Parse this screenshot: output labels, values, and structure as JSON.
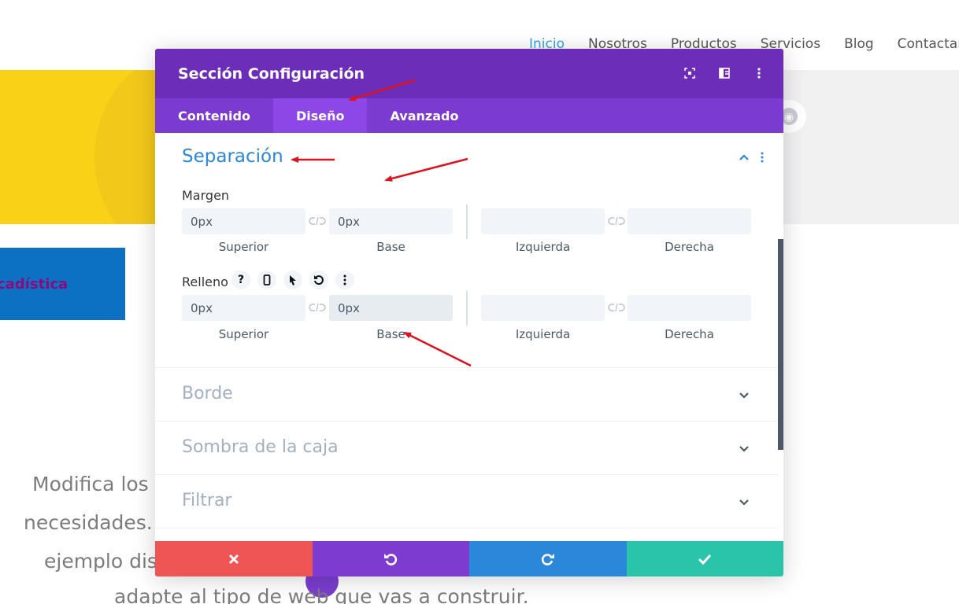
{
  "nav": {
    "items": [
      "Inicio",
      "Nosotros",
      "Productos",
      "Servicios",
      "Blog",
      "Contactar"
    ]
  },
  "background": {
    "blue_button_label": "cadística",
    "text_lines": [
      "Modifica los",
      "necesidades.",
      "ejemplo dis",
      "adapte al tipo de web que vas a construir."
    ]
  },
  "modal": {
    "title": "Sección Configuración",
    "header_icons": [
      "expand-icon",
      "split-view-icon",
      "more-vertical-icon"
    ],
    "tabs": [
      "Contenido",
      "Diseño",
      "Avanzado"
    ],
    "active_tab": "Diseño",
    "section": {
      "title": "Separación",
      "margin": {
        "label": "Margen",
        "fields": [
          {
            "value": "0px",
            "sub": "Superior"
          },
          {
            "value": "0px",
            "sub": "Base"
          },
          {
            "value": "",
            "sub": "Izquierda"
          },
          {
            "value": "",
            "sub": "Derecha"
          }
        ]
      },
      "padding": {
        "label": "Relleno",
        "tool_icons": [
          "help-icon",
          "mobile-icon",
          "hover-cursor-icon",
          "reset-icon",
          "more-icon"
        ],
        "tool_glyphs": [
          "?",
          "▯",
          "➤",
          "↺",
          "⋮"
        ],
        "fields": [
          {
            "value": "0px",
            "sub": "Superior"
          },
          {
            "value": "0px",
            "sub": "Base"
          },
          {
            "value": "",
            "sub": "Izquierda"
          },
          {
            "value": "",
            "sub": "Derecha"
          }
        ]
      }
    },
    "accordions": [
      "Borde",
      "Sombra de la caja",
      "Filtrar"
    ],
    "footer": [
      "cancel-icon",
      "undo-icon",
      "redo-icon",
      "save-icon"
    ]
  },
  "colors": {
    "header": "#6c2eb9",
    "tabs": "#7b3bd0",
    "active_tab": "#8d47e6",
    "section_title": "#2b87da",
    "cancel": "#ef5555",
    "undo": "#7e3bd0",
    "redo": "#2b87da",
    "save": "#29c4a9",
    "annotation_arrow": "#e0121d"
  }
}
